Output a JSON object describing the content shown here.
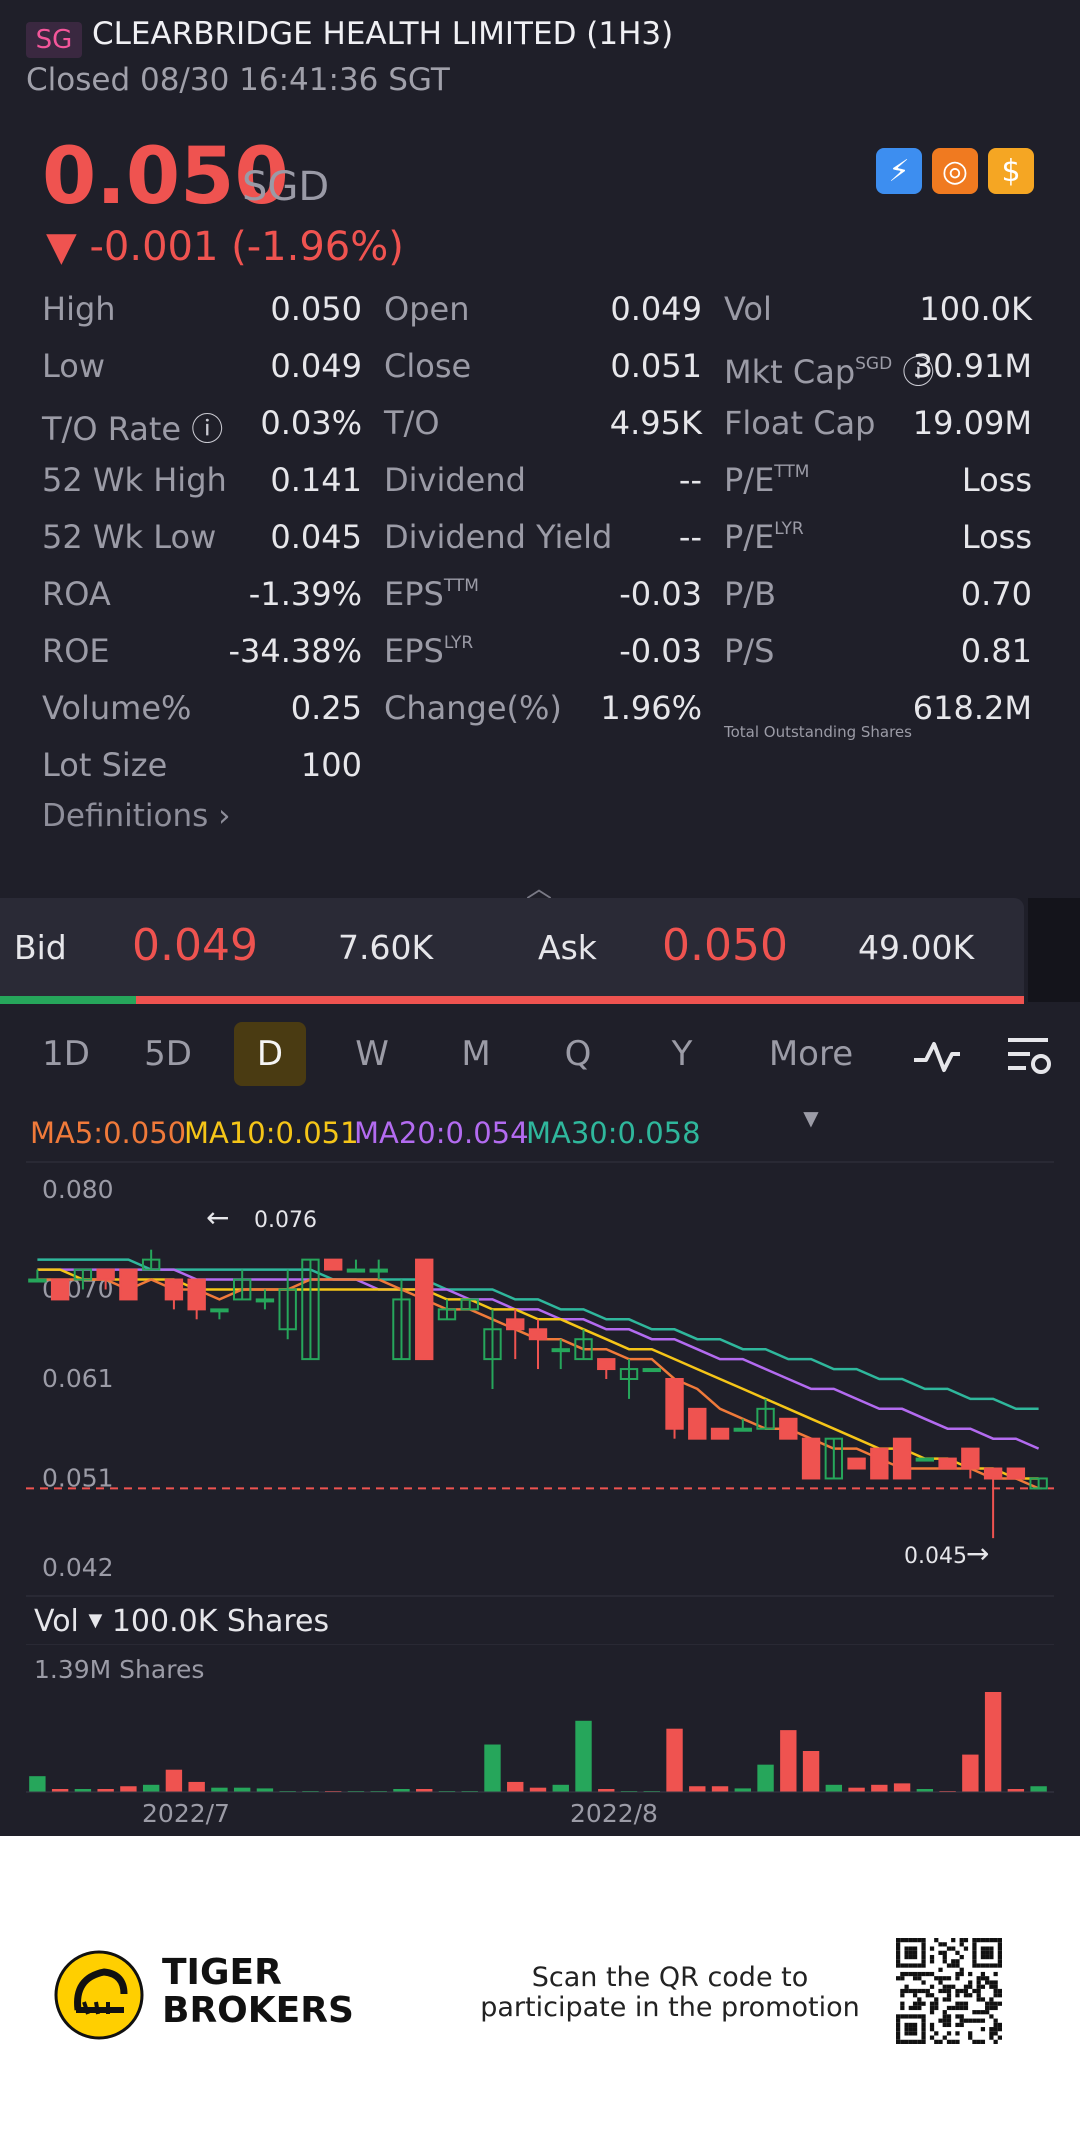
{
  "header": {
    "market_tag": "SG",
    "title": "CLEARBRIDGE HEALTH LIMITED (1H3)",
    "status": "Closed 08/30 16:41:36 SGT"
  },
  "quote": {
    "price": "0.050",
    "currency": "SGD",
    "change": "▼ -0.001 (-1.96%)",
    "badges": [
      {
        "icon": "lightning-icon",
        "glyph": "⚡",
        "color": "#3d8ef0"
      },
      {
        "icon": "basketball-icon",
        "glyph": "◎",
        "color": "#f07a20"
      },
      {
        "icon": "dollar-icon",
        "glyph": "$",
        "color": "#f5a623"
      }
    ]
  },
  "stats": [
    [
      [
        "High",
        "0.050"
      ],
      [
        "Open",
        "0.049"
      ],
      [
        "Vol",
        "100.0K"
      ]
    ],
    [
      [
        "Low",
        "0.049"
      ],
      [
        "Close",
        "0.051"
      ],
      [
        "Mkt Cap",
        "30.91M"
      ]
    ],
    [
      [
        "T/O Rate",
        "0.03%"
      ],
      [
        "T/O",
        "4.95K"
      ],
      [
        "Float Cap",
        "19.09M"
      ]
    ],
    [
      [
        "52 Wk High",
        "0.141"
      ],
      [
        "Dividend",
        "--"
      ],
      [
        "P/E",
        "Loss"
      ]
    ],
    [
      [
        "52 Wk Low",
        "0.045"
      ],
      [
        "Dividend Yield",
        "--"
      ],
      [
        "P/E",
        "Loss"
      ]
    ],
    [
      [
        "ROA",
        "-1.39%"
      ],
      [
        "EPS",
        "-0.03"
      ],
      [
        "P/B",
        "0.70"
      ]
    ],
    [
      [
        "ROE",
        "-34.38%"
      ],
      [
        "EPS",
        "-0.03"
      ],
      [
        "P/S",
        "0.81"
      ]
    ],
    [
      [
        "Volume%",
        "0.25"
      ],
      [
        "Change(%)",
        "1.96%"
      ],
      [
        "Total Outstanding Shares",
        "618.2M"
      ]
    ],
    [
      [
        "Lot Size",
        "100"
      ],
      [
        "",
        ""
      ],
      [
        "",
        ""
      ]
    ]
  ],
  "superscripts": {
    "mkt_cap": "SGD",
    "pe_ttm": "TTM",
    "pe_lyr": "LYR",
    "eps_ttm": "TTM",
    "eps_lyr": "LYR"
  },
  "definitions_label": "Definitions",
  "orderbook": {
    "bid_label": "Bid",
    "bid_price": "0.049",
    "bid_size": "7.60K",
    "ask_label": "Ask",
    "ask_price": "0.050",
    "ask_size": "49.00K"
  },
  "timeframes": [
    "1D",
    "5D",
    "D",
    "W",
    "M",
    "Q",
    "Y"
  ],
  "active_timeframe": "D",
  "more_label": "More",
  "ma_legend": [
    {
      "text": "MA5:0.050",
      "color": "#f07a3a"
    },
    {
      "text": "MA10:0.051",
      "color": "#f5c518"
    },
    {
      "text": "MA20:0.054",
      "color": "#b36bf0"
    },
    {
      "text": "MA30:0.058",
      "color": "#2fb79c"
    }
  ],
  "chart_data": {
    "type": "candlestick",
    "y_ticks": [
      "0.080",
      "0.070",
      "0.061",
      "0.051",
      "0.042"
    ],
    "ylim": [
      0.042,
      0.08
    ],
    "high_marker": "0.076",
    "low_marker": "0.045",
    "last_price_line": 0.05,
    "x_labels": [
      "2022/7",
      "2022/8"
    ],
    "candles": [
      [
        0.071,
        0.072,
        0.071,
        0.071
      ],
      [
        0.071,
        0.071,
        0.069,
        0.069
      ],
      [
        0.071,
        0.072,
        0.07,
        0.072
      ],
      [
        0.072,
        0.072,
        0.07,
        0.071
      ],
      [
        0.072,
        0.072,
        0.069,
        0.069
      ],
      [
        0.072,
        0.074,
        0.072,
        0.073
      ],
      [
        0.071,
        0.071,
        0.068,
        0.069
      ],
      [
        0.071,
        0.071,
        0.067,
        0.068
      ],
      [
        0.068,
        0.068,
        0.067,
        0.068
      ],
      [
        0.069,
        0.072,
        0.069,
        0.071
      ],
      [
        0.069,
        0.07,
        0.068,
        0.069
      ],
      [
        0.066,
        0.072,
        0.065,
        0.07
      ],
      [
        0.063,
        0.073,
        0.063,
        0.073
      ],
      [
        0.073,
        0.073,
        0.072,
        0.072
      ],
      [
        0.072,
        0.073,
        0.072,
        0.072
      ],
      [
        0.072,
        0.073,
        0.071,
        0.072
      ],
      [
        0.063,
        0.071,
        0.063,
        0.069
      ],
      [
        0.073,
        0.073,
        0.063,
        0.063
      ],
      [
        0.067,
        0.069,
        0.067,
        0.068
      ],
      [
        0.068,
        0.069,
        0.068,
        0.069
      ],
      [
        0.063,
        0.068,
        0.06,
        0.066
      ],
      [
        0.067,
        0.068,
        0.063,
        0.066
      ],
      [
        0.066,
        0.067,
        0.062,
        0.065
      ],
      [
        0.064,
        0.065,
        0.062,
        0.064
      ],
      [
        0.063,
        0.066,
        0.063,
        0.065
      ],
      [
        0.063,
        0.063,
        0.061,
        0.062
      ],
      [
        0.061,
        0.063,
        0.059,
        0.062
      ],
      [
        0.062,
        0.062,
        0.062,
        0.062
      ],
      [
        0.061,
        0.061,
        0.055,
        0.056
      ],
      [
        0.058,
        0.058,
        0.055,
        0.055
      ],
      [
        0.056,
        0.056,
        0.055,
        0.055
      ],
      [
        0.056,
        0.057,
        0.056,
        0.056
      ],
      [
        0.056,
        0.059,
        0.056,
        0.058
      ],
      [
        0.057,
        0.057,
        0.055,
        0.055
      ],
      [
        0.055,
        0.055,
        0.051,
        0.051
      ],
      [
        0.051,
        0.055,
        0.051,
        0.055
      ],
      [
        0.053,
        0.053,
        0.052,
        0.052
      ],
      [
        0.054,
        0.054,
        0.051,
        0.051
      ],
      [
        0.055,
        0.055,
        0.051,
        0.051
      ],
      [
        0.053,
        0.053,
        0.053,
        0.053
      ],
      [
        0.053,
        0.053,
        0.052,
        0.052
      ],
      [
        0.054,
        0.054,
        0.051,
        0.052
      ],
      [
        0.052,
        0.052,
        0.045,
        0.051
      ],
      [
        0.052,
        0.052,
        0.051,
        0.051
      ],
      [
        0.05,
        0.051,
        0.05,
        0.051
      ]
    ],
    "ma5": [
      0.071,
      0.071,
      0.071,
      0.071,
      0.07,
      0.071,
      0.07,
      0.07,
      0.069,
      0.07,
      0.07,
      0.07,
      0.071,
      0.071,
      0.071,
      0.071,
      0.07,
      0.069,
      0.068,
      0.068,
      0.067,
      0.066,
      0.065,
      0.065,
      0.064,
      0.064,
      0.063,
      0.063,
      0.061,
      0.06,
      0.058,
      0.057,
      0.056,
      0.056,
      0.055,
      0.054,
      0.054,
      0.053,
      0.052,
      0.052,
      0.052,
      0.052,
      0.051,
      0.051,
      0.05
    ],
    "ma10": [
      0.072,
      0.072,
      0.071,
      0.071,
      0.071,
      0.071,
      0.071,
      0.07,
      0.07,
      0.07,
      0.07,
      0.07,
      0.07,
      0.07,
      0.07,
      0.07,
      0.07,
      0.07,
      0.069,
      0.069,
      0.068,
      0.068,
      0.067,
      0.067,
      0.066,
      0.065,
      0.064,
      0.064,
      0.063,
      0.062,
      0.061,
      0.06,
      0.059,
      0.058,
      0.057,
      0.056,
      0.055,
      0.054,
      0.054,
      0.053,
      0.053,
      0.052,
      0.052,
      0.051,
      0.051
    ],
    "ma20": [
      0.072,
      0.072,
      0.072,
      0.072,
      0.072,
      0.072,
      0.072,
      0.071,
      0.071,
      0.071,
      0.071,
      0.071,
      0.071,
      0.071,
      0.071,
      0.07,
      0.07,
      0.07,
      0.07,
      0.069,
      0.069,
      0.068,
      0.068,
      0.067,
      0.067,
      0.066,
      0.066,
      0.065,
      0.065,
      0.064,
      0.063,
      0.063,
      0.062,
      0.061,
      0.06,
      0.06,
      0.059,
      0.058,
      0.058,
      0.057,
      0.056,
      0.056,
      0.055,
      0.055,
      0.054
    ],
    "ma30": [
      0.073,
      0.073,
      0.073,
      0.073,
      0.073,
      0.072,
      0.072,
      0.072,
      0.072,
      0.072,
      0.072,
      0.072,
      0.072,
      0.071,
      0.071,
      0.071,
      0.071,
      0.071,
      0.07,
      0.07,
      0.07,
      0.069,
      0.069,
      0.068,
      0.068,
      0.067,
      0.067,
      0.066,
      0.066,
      0.065,
      0.065,
      0.064,
      0.064,
      0.063,
      0.063,
      0.062,
      0.062,
      0.061,
      0.061,
      0.06,
      0.06,
      0.059,
      0.059,
      0.058,
      0.058
    ]
  },
  "volume": {
    "label": "Vol",
    "current": "100.0K Shares",
    "max_label": "1.39M Shares",
    "max": 1.39,
    "values": [
      0.22,
      0.03,
      0.03,
      0.03,
      0.08,
      0.1,
      0.31,
      0.14,
      0.06,
      0.06,
      0.05,
      0.0,
      0.0,
      0.0,
      0.0,
      0.0,
      0.02,
      0.03,
      0.0,
      0.0,
      0.66,
      0.14,
      0.06,
      0.1,
      0.99,
      0.03,
      0.0,
      0.0,
      0.88,
      0.08,
      0.08,
      0.05,
      0.38,
      0.86,
      0.57,
      0.1,
      0.06,
      0.1,
      0.12,
      0.03,
      0.0,
      0.52,
      1.39,
      0.03,
      0.08
    ]
  },
  "footer": {
    "brand_line1": "TIGER",
    "brand_line2": "BROKERS",
    "promo_line1": "Scan the QR code to",
    "promo_line2": "participate in the promotion"
  }
}
